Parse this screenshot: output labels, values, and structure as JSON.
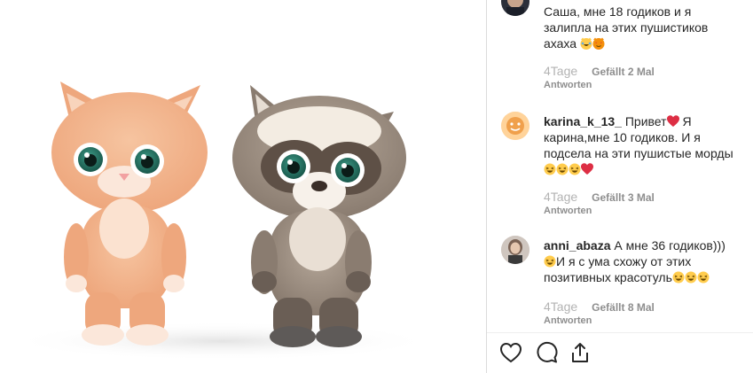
{
  "comments": [
    {
      "text": "Саша, мне 18 годиков и я залипла на этих пушистиков ахаха",
      "emojis": [
        "laugh-cry-cat",
        "heart-eyes-cat"
      ],
      "ago": "4Tage",
      "likes": "Gefällt 2 Mal",
      "reply": "Antworten"
    },
    {
      "username": "karina_k_13_",
      "text_a": "Привет",
      "text_b": "Я карина,мне 10 годиков. И я подсела на эти пушистые морды",
      "emojis": [
        "laughing",
        "laughing",
        "laughing",
        "red-heart"
      ],
      "ago": "4Tage",
      "likes": "Gefällt 3 Mal",
      "reply": "Antworten"
    },
    {
      "username": "anni_abaza",
      "text_a": "А мне 36 годиков)))",
      "text_b": "И я с ума схожу от этих позитивных красотуль",
      "emojis_a": [
        "laughing"
      ],
      "emojis_b": [
        "laughing",
        "laughing",
        "laughing"
      ],
      "ago": "4Tage",
      "likes": "Gefällt 8 Mal",
      "reply": "Antworten"
    }
  ],
  "actions": [
    "heart-icon",
    "comment-icon",
    "share-icon"
  ],
  "colors": {
    "text": "#262626",
    "meta": "#8e8e8e",
    "divider": "#dbdbdb",
    "heart_red": "#ed4956",
    "emoji_yellow": "#ffcc4d"
  }
}
